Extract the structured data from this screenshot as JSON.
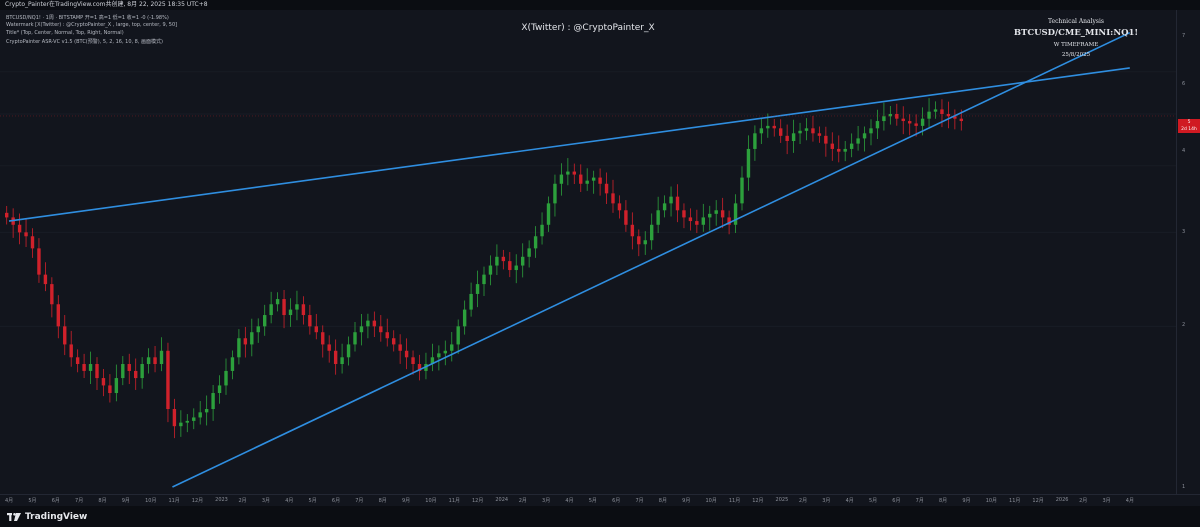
{
  "header": {
    "topbar_text": "Crypto_Painter在TradingView.com共创建, 8月 22, 2025 18:35 UTC+8"
  },
  "legend": {
    "line1": "BTCUSD/NQ1! · 1周 · BITSTAMP  开=1  高=1  低=1  收=1  -0 (-1.98%)",
    "line2": "Watermark [X(Twitter) : @CryptoPainter_X , large, top, center, 9, 50]",
    "line3": "Title* (Top, Center, Normal, Top, Right, Normal)",
    "line4": "CryptoPainter ASR-VC v1.5 (BTC(预警), 5, 2, 16, 10, 8, 画面模式)"
  },
  "watermark": "X(Twitter) : @CryptoPainter_X",
  "title_block": {
    "title": "Technical Analysis",
    "symbol": "BTCUSD/CME_MINI:NQ1!",
    "timeframe": "W TIMEFRAME",
    "date": "25/8/2025"
  },
  "price_axis": {
    "ticks": [
      "7",
      "6",
      "5",
      "4",
      "3",
      "2",
      "1"
    ],
    "current_price": "5",
    "countdown": "2d 14h"
  },
  "time_axis": {
    "labels": [
      "4月",
      "5月",
      "6月",
      "7月",
      "8月",
      "9月",
      "10月",
      "11月",
      "12月",
      "2023",
      "2月",
      "3月",
      "4月",
      "5月",
      "6月",
      "7月",
      "8月",
      "9月",
      "10月",
      "11月",
      "12月",
      "2024",
      "2月",
      "3月",
      "4月",
      "5月",
      "6月",
      "7月",
      "8月",
      "9月",
      "10月",
      "11月",
      "12月",
      "2025",
      "2月",
      "3月",
      "4月",
      "5月",
      "6月",
      "7月",
      "8月",
      "9月",
      "10月",
      "11月",
      "12月",
      "2026",
      "2月",
      "3月",
      "4月"
    ]
  },
  "footer": {
    "brand": "TradingView"
  },
  "colors": {
    "up": "#2ca03c",
    "down": "#d0212b",
    "trendline": "#2f8ee0",
    "background": "#12151d"
  },
  "chart_data": {
    "type": "candlestick",
    "symbol": "BTCUSD/CME_MINI:NQ1!",
    "timeframe": "W",
    "y_scale": "log",
    "ylim": [
      1,
      7.3
    ],
    "close_path": [
      3.2,
      3.1,
      3.0,
      2.95,
      2.8,
      2.5,
      2.4,
      2.2,
      2.0,
      1.85,
      1.75,
      1.7,
      1.65,
      1.7,
      1.6,
      1.55,
      1.5,
      1.6,
      1.7,
      1.65,
      1.6,
      1.7,
      1.75,
      1.7,
      1.8,
      1.4,
      1.3,
      1.32,
      1.33,
      1.35,
      1.38,
      1.4,
      1.5,
      1.55,
      1.65,
      1.75,
      1.9,
      1.85,
      1.95,
      2.0,
      2.1,
      2.2,
      2.25,
      2.1,
      2.15,
      2.2,
      2.1,
      2.0,
      1.95,
      1.85,
      1.8,
      1.7,
      1.75,
      1.85,
      1.95,
      2.0,
      2.05,
      2.0,
      1.95,
      1.9,
      1.85,
      1.8,
      1.75,
      1.7,
      1.65,
      1.7,
      1.75,
      1.78,
      1.8,
      1.85,
      2.0,
      2.15,
      2.3,
      2.4,
      2.5,
      2.6,
      2.7,
      2.65,
      2.55,
      2.6,
      2.7,
      2.8,
      2.95,
      3.1,
      3.4,
      3.7,
      3.85,
      3.9,
      3.85,
      3.7,
      3.75,
      3.8,
      3.7,
      3.55,
      3.4,
      3.3,
      3.1,
      2.95,
      2.85,
      2.9,
      3.1,
      3.3,
      3.4,
      3.5,
      3.3,
      3.2,
      3.15,
      3.1,
      3.2,
      3.25,
      3.3,
      3.2,
      3.1,
      3.4,
      3.8,
      4.3,
      4.6,
      4.7,
      4.75,
      4.7,
      4.55,
      4.45,
      4.6,
      4.65,
      4.7,
      4.6,
      4.55,
      4.4,
      4.3,
      4.25,
      4.3,
      4.4,
      4.5,
      4.6,
      4.7,
      4.85,
      4.95,
      5.0,
      4.9,
      4.85,
      4.8,
      4.75,
      4.9,
      5.05,
      5.1,
      5.0,
      4.95,
      4.9,
      4.85
    ],
    "trendlines": [
      {
        "label": "upper",
        "from": [
          "2022-04",
          3.15
        ],
        "to": [
          "2026-04",
          6.1
        ]
      },
      {
        "label": "lower",
        "from": [
          "2022-11",
          1.0
        ],
        "to": [
          "2026-04",
          7.1
        ]
      }
    ],
    "last_price": 5
  }
}
